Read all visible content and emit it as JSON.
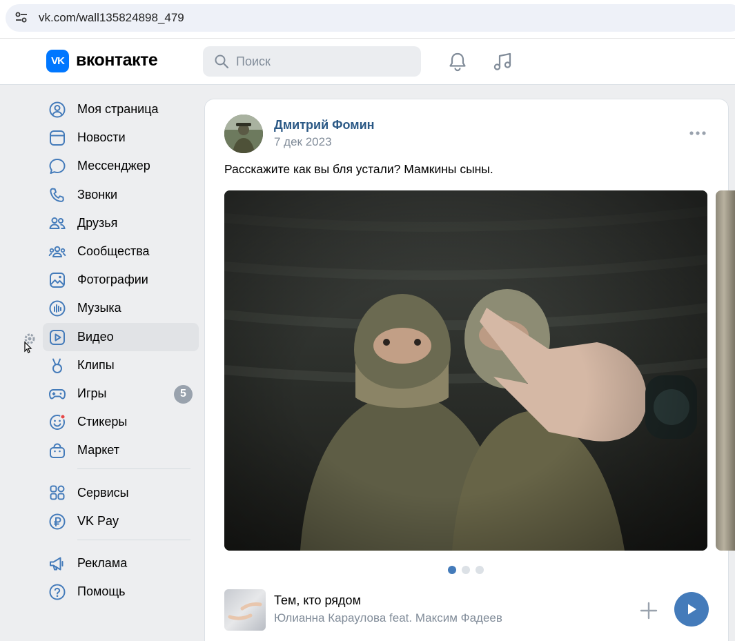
{
  "browser": {
    "url": "vk.com/wall135824898_479"
  },
  "header": {
    "logo_text": "вконтакте",
    "logo_mark": "VK",
    "search_placeholder": "Поиск"
  },
  "sidebar": {
    "items": [
      {
        "label": "Моя страница",
        "icon": "user-circle-icon"
      },
      {
        "label": "Новости",
        "icon": "news-icon"
      },
      {
        "label": "Мессенджер",
        "icon": "message-icon"
      },
      {
        "label": "Звонки",
        "icon": "phone-icon"
      },
      {
        "label": "Друзья",
        "icon": "friends-icon"
      },
      {
        "label": "Сообщества",
        "icon": "communities-icon"
      },
      {
        "label": "Фотографии",
        "icon": "photo-icon"
      },
      {
        "label": "Музыка",
        "icon": "music-icon"
      },
      {
        "label": "Видео",
        "icon": "video-icon",
        "active": true
      },
      {
        "label": "Клипы",
        "icon": "clips-icon"
      },
      {
        "label": "Игры",
        "icon": "games-icon",
        "badge": "5"
      },
      {
        "label": "Стикеры",
        "icon": "stickers-icon"
      },
      {
        "label": "Маркет",
        "icon": "market-icon"
      }
    ],
    "secondary": [
      {
        "label": "Сервисы",
        "icon": "services-icon"
      },
      {
        "label": "VK Pay",
        "icon": "vkpay-icon"
      }
    ],
    "tertiary": [
      {
        "label": "Реклама",
        "icon": "ads-icon"
      },
      {
        "label": "Помощь",
        "icon": "help-icon"
      }
    ]
  },
  "post": {
    "author": "Дмитрий Фомин",
    "date": "7 дек 2023",
    "text": "Расскажите как вы бля устали? Мамкины сыны.",
    "carousel": {
      "total": 3,
      "current": 1
    }
  },
  "audio": {
    "title": "Тем, кто рядом",
    "artist": "Юлианна Караулова feat. Максим Фадеев"
  },
  "colors": {
    "accent": "#0077ff",
    "link": "#2a5885",
    "play": "#447bba",
    "page_bg": "#edeef0"
  }
}
